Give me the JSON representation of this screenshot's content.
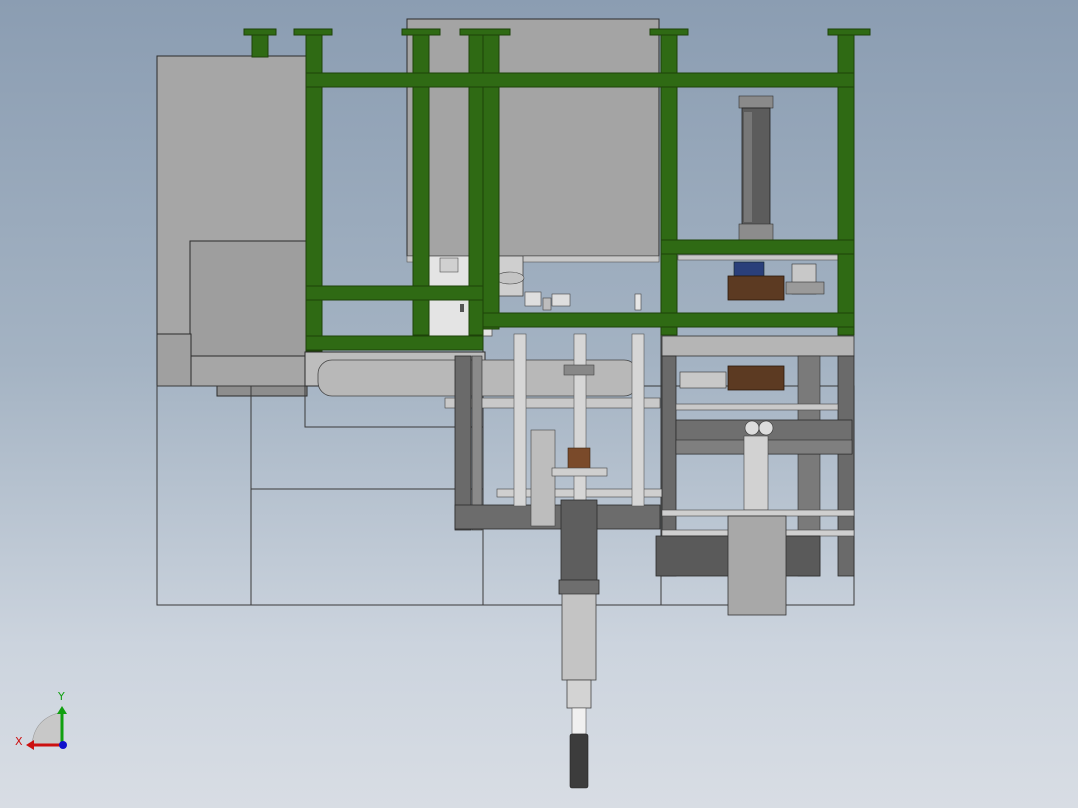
{
  "viewport": {
    "background_top": "#8b9db2",
    "background_bottom": "#d8dde4"
  },
  "colors": {
    "frame_green": "#2f6a14",
    "frame_edge": "#1d4209",
    "housing_grey": "#a3a3a3",
    "steel_light": "#d0d0d0",
    "steel_dark": "#3d3d3d",
    "outline": "#2b2b2b",
    "brown_block": "#5c3a22",
    "rod": "#d6d6d6"
  },
  "triad": {
    "x_label": "X",
    "y_label": "Y",
    "x_color": "#cc1010",
    "y_color": "#10a010",
    "z_color": "#1010cc"
  }
}
